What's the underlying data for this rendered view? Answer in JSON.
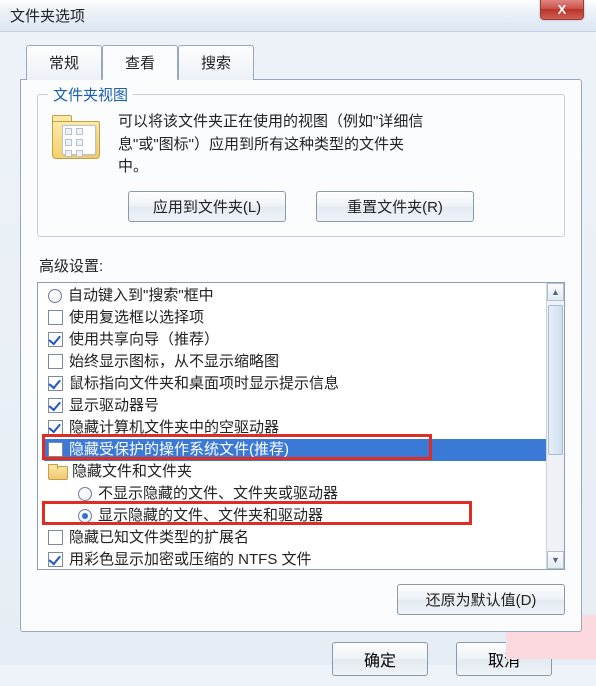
{
  "window": {
    "title": "文件夹选项"
  },
  "tabs": {
    "t0": "常规",
    "t1": "查看",
    "t2": "搜索"
  },
  "folderView": {
    "legend": "文件夹视图",
    "desc_l1": "可以将该文件夹正在使用的视图（例如\"详细信",
    "desc_l2": "息\"或\"图标\"）应用到所有这种类型的文件夹",
    "desc_l3": "中。",
    "applyBtn": "应用到文件夹(L)",
    "resetBtn": "重置文件夹(R)"
  },
  "advanced": {
    "label": "高级设置:",
    "items": {
      "i0": "自动键入到\"搜索\"框中",
      "i1": "使用复选框以选择项",
      "i2": "使用共享向导（推荐）",
      "i3": "始终显示图标，从不显示缩略图",
      "i4": "鼠标指向文件夹和桌面项时显示提示信息",
      "i5": "显示驱动器号",
      "i6": "隐藏计算机文件夹中的空驱动器",
      "i7": "隐藏受保护的操作系统文件(推荐)",
      "i8": "隐藏文件和文件夹",
      "i9": "不显示隐藏的文件、文件夹或驱动器",
      "i10": "显示隐藏的文件、文件夹和驱动器",
      "i11": "隐藏已知文件类型的扩展名",
      "i12": "用彩色显示加密或压缩的 NTFS 文件"
    },
    "restoreBtn": "还原为默认值(D)"
  },
  "footer": {
    "ok": "确定",
    "cancel": "取消"
  }
}
